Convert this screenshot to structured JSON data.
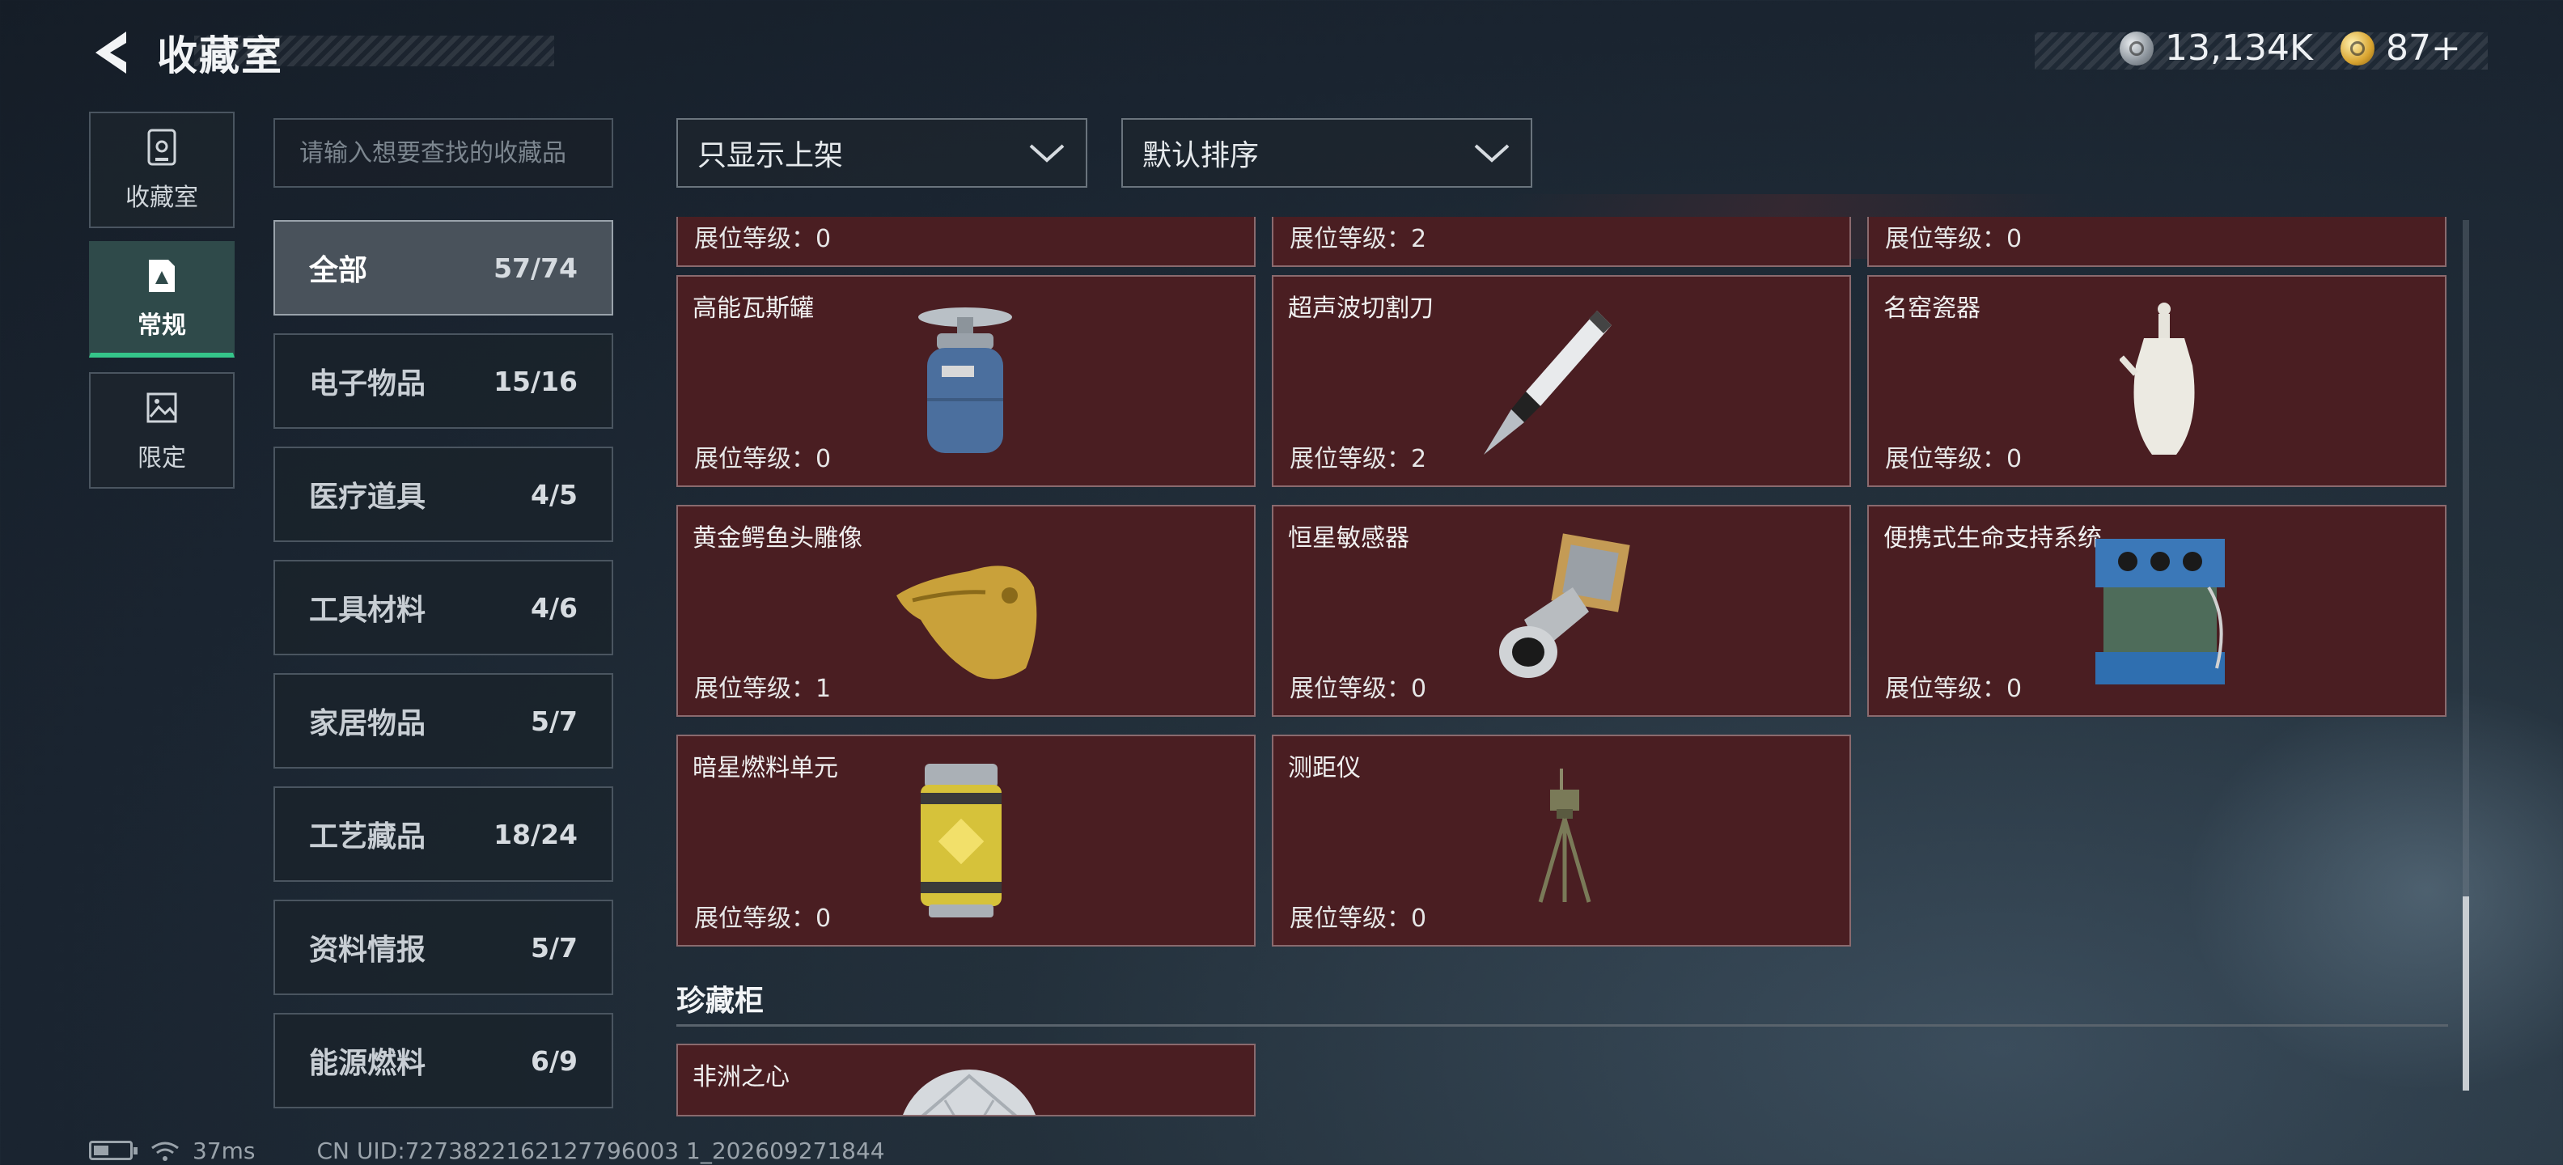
{
  "header": {
    "title": "收藏室",
    "currency": [
      {
        "icon": "silver-coin-icon",
        "value": "13,134K"
      },
      {
        "icon": "gold-coin-icon",
        "value": "87+"
      }
    ]
  },
  "side_tabs": [
    {
      "label": "收藏室",
      "icon": "collection-room-icon",
      "active": false
    },
    {
      "label": "常规",
      "icon": "regular-card-icon",
      "active": true
    },
    {
      "label": "限定",
      "icon": "limited-image-icon",
      "active": false
    }
  ],
  "search": {
    "placeholder": "请输入想要查找的收藏品"
  },
  "categories": [
    {
      "label": "全部",
      "count": "57/74",
      "active": true
    },
    {
      "label": "电子物品",
      "count": "15/16"
    },
    {
      "label": "医疗道具",
      "count": "4/5"
    },
    {
      "label": "工具材料",
      "count": "4/6"
    },
    {
      "label": "家居物品",
      "count": "5/7"
    },
    {
      "label": "工艺藏品",
      "count": "18/24"
    },
    {
      "label": "资料情报",
      "count": "5/7"
    },
    {
      "label": "能源燃料",
      "count": "6/9"
    }
  ],
  "filters": {
    "show_filter": "只显示上架",
    "sort": "默认排序"
  },
  "items": [
    {
      "name": "",
      "level_label": "展位等级：",
      "level": "0"
    },
    {
      "name": "",
      "level_label": "展位等级：",
      "level": "2"
    },
    {
      "name": "",
      "level_label": "展位等级：",
      "level": "0"
    },
    {
      "name": "高能瓦斯罐",
      "level_label": "展位等级：",
      "level": "0",
      "icon": "gas-canister-icon"
    },
    {
      "name": "超声波切割刀",
      "level_label": "展位等级：",
      "level": "2",
      "icon": "ultrasonic-knife-icon"
    },
    {
      "name": "名窑瓷器",
      "level_label": "展位等级：",
      "level": "0",
      "icon": "porcelain-vase-icon"
    },
    {
      "name": "黄金鳄鱼头雕像",
      "level_label": "展位等级：",
      "level": "1",
      "icon": "gold-crocodile-statue-icon"
    },
    {
      "name": "恒星敏感器",
      "level_label": "展位等级：",
      "level": "0",
      "icon": "star-sensor-icon"
    },
    {
      "name": "便携式生命支持系统",
      "level_label": "展位等级：",
      "level": "0",
      "icon": "life-support-system-icon"
    },
    {
      "name": "暗星燃料单元",
      "level_label": "展位等级：",
      "level": "0",
      "icon": "fuel-cell-icon"
    },
    {
      "name": "测距仪",
      "level_label": "展位等级：",
      "level": "0",
      "icon": "rangefinder-tripod-icon"
    }
  ],
  "section": {
    "title": "珍藏柜"
  },
  "treasure_items": [
    {
      "name": "非洲之心",
      "icon": "diamond-icon"
    }
  ],
  "status": {
    "ping": "37ms",
    "uid": "CN UID:7273822162127796003 1_202609271844"
  }
}
